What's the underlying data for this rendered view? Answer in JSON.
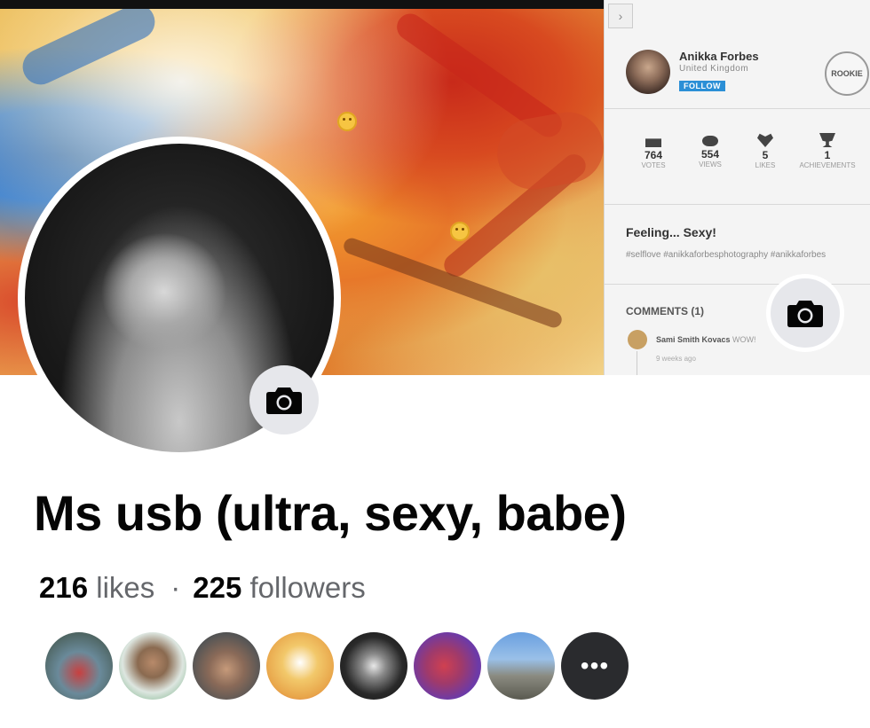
{
  "panel": {
    "nav_chevron": "›",
    "author_name": "Anikka Forbes",
    "author_country": "United Kingdom",
    "follow_label": "FOLLOW",
    "rank_badge": "ROOKIE",
    "stats": [
      {
        "icon": "ballot-box-icon",
        "value": "764",
        "label": "VOTES"
      },
      {
        "icon": "eye-icon",
        "value": "554",
        "label": "VIEWS"
      },
      {
        "icon": "heart-icon",
        "value": "5",
        "label": "LIKES"
      },
      {
        "icon": "trophy-icon",
        "value": "1",
        "label": "ACHIEVEMENTS"
      }
    ],
    "post_title": "Feeling... Sexy!",
    "post_tags": "#selflove #anikkaforbesphotography #anikkaforbes",
    "comments_title": "COMMENTS (1)",
    "comment": {
      "author": "Sami Smith Kovacs",
      "text": "WOW!",
      "time": "9 weeks ago"
    }
  },
  "profile": {
    "name": "Ms usb (ultra, sexy, babe)",
    "likes_count": "216",
    "likes_label": "likes",
    "separator": "·",
    "followers_count": "225",
    "followers_label": "followers",
    "friends": [
      {
        "name": "friend-1"
      },
      {
        "name": "friend-2"
      },
      {
        "name": "friend-3"
      },
      {
        "name": "friend-4"
      },
      {
        "name": "friend-5"
      },
      {
        "name": "friend-6"
      },
      {
        "name": "friend-7"
      }
    ],
    "more_label": "•••"
  },
  "colors": {
    "accent_follow": "#2b8fd6",
    "name_text": "#050505",
    "secondary_text": "#65676b",
    "camera_button_bg": "#e6e7eb"
  }
}
